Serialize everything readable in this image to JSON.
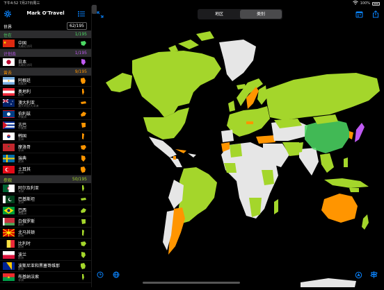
{
  "status_bar": {
    "time": "下午4:52",
    "date": "7月27日周三",
    "battery": "100%"
  },
  "sidebar": {
    "title": "Mark O'Travel",
    "world": {
      "label": "世界",
      "count": "62/195"
    },
    "sections": [
      {
        "name": "住在",
        "count": "1/195",
        "color": "#4cd964",
        "items": [
          {
            "name": "中国",
            "sub": "无最近访问",
            "flag": "cn",
            "color": "#4cd964"
          }
        ]
      },
      {
        "name": "计划去",
        "count": "1/195",
        "color": "#bf5af2",
        "items": [
          {
            "name": "日本",
            "sub": "无最近访问",
            "flag": "jp",
            "color": "#bf5af2"
          }
        ]
      },
      {
        "name": "曾去",
        "count": "9/195",
        "color": "#ff9500",
        "items": [
          {
            "name": "阿根廷",
            "sub": "南美洲",
            "flag": "ar",
            "color": "#ff9500"
          },
          {
            "name": "奥地利",
            "sub": "欧洲",
            "flag": "at",
            "color": "#ff9500"
          },
          {
            "name": "澳大利亚",
            "sub": "澳大利亚/大洋洲",
            "flag": "au",
            "color": "#ff9500"
          },
          {
            "name": "伯利兹",
            "sub": "中美洲",
            "flag": "bz",
            "color": "#ff9500"
          },
          {
            "name": "古巴",
            "sub": "中美洲",
            "flag": "cu",
            "color": "#ff9500"
          },
          {
            "name": "韩国",
            "sub": "亚洲",
            "flag": "kr",
            "color": "#ff9500"
          },
          {
            "name": "摩洛哥",
            "sub": "非洲",
            "flag": "ma",
            "color": "#ff9500"
          },
          {
            "name": "瑞典",
            "sub": "欧洲",
            "flag": "se",
            "color": "#ff9500"
          },
          {
            "name": "土耳其",
            "sub": "欧洲",
            "flag": "tr",
            "color": "#ff9500"
          }
        ]
      },
      {
        "name": "参观",
        "count": "50/195",
        "color": "#a4d62b",
        "items": [
          {
            "name": "阿尔及利亚",
            "sub": "非洲",
            "flag": "dz",
            "color": "#a4d62b"
          },
          {
            "name": "巴基斯坦",
            "sub": "亚洲",
            "flag": "pk",
            "color": "#a4d62b"
          },
          {
            "name": "巴西",
            "sub": "南美洲",
            "flag": "br",
            "color": "#a4d62b"
          },
          {
            "name": "白俄罗斯",
            "sub": "欧洲",
            "flag": "by",
            "color": "#a4d62b"
          },
          {
            "name": "北马其顿",
            "sub": "欧洲",
            "flag": "mk",
            "color": "#a4d62b"
          },
          {
            "name": "比利时",
            "sub": "欧洲",
            "flag": "be",
            "color": "#a4d62b"
          },
          {
            "name": "波兰",
            "sub": "欧洲",
            "flag": "pl",
            "color": "#a4d62b"
          },
          {
            "name": "波斯尼亚和黑塞哥维那",
            "sub": "欧洲",
            "flag": "ba",
            "color": "#a4d62b"
          },
          {
            "name": "布基纳法索",
            "sub": "非洲",
            "flag": "bf",
            "color": "#a4d62b"
          }
        ]
      }
    ]
  },
  "map": {
    "segments": [
      {
        "label": "地区",
        "selected": false
      },
      {
        "label": "类别",
        "selected": true
      }
    ],
    "colors": {
      "visited": "#a4d62b",
      "been": "#ff9500",
      "live": "#4cd964",
      "plan": "#bf5af2",
      "none": "#e6e6e6"
    }
  }
}
